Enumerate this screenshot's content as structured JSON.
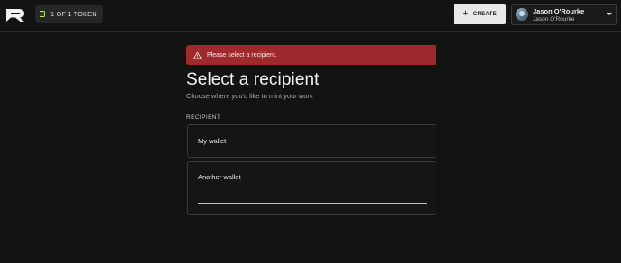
{
  "header": {
    "logo_icon": "brand-logo-icon",
    "token_badge": {
      "label": "1 OF 1 TOKEN",
      "icon": "token-icon"
    },
    "create_button": {
      "label": "CREATE",
      "icon": "plus-icon"
    },
    "user": {
      "name": "Jason O'Rourke",
      "handle": "Jason O'Rourke",
      "icon": "chevron-down-icon"
    }
  },
  "alert": {
    "icon": "warning-icon",
    "message": "Please select a recipient.",
    "color": "#9f2a2e"
  },
  "main": {
    "title": "Select a recipient",
    "subtitle": "Choose where you'd like to mint your work",
    "recipient_label": "RECIPIENT",
    "options": [
      {
        "label": "My wallet"
      },
      {
        "label": "Another wallet",
        "input_value": "",
        "input_placeholder": ""
      }
    ]
  }
}
